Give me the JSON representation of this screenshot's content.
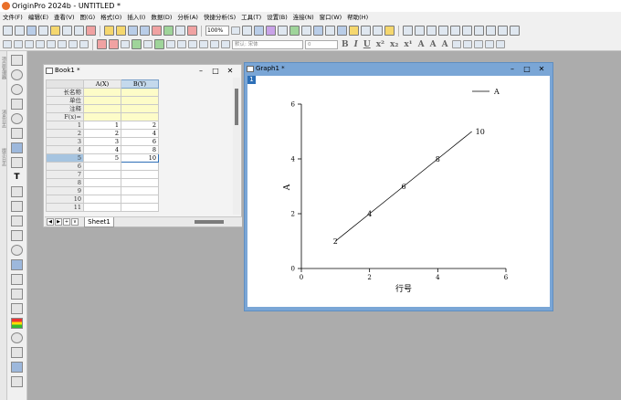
{
  "app": {
    "title": "OriginPro 2024b - UNTITLED *"
  },
  "menu": [
    "文件(F)",
    "编辑(E)",
    "查看(V)",
    "图(G)",
    "格式(O)",
    "插入(I)",
    "数据(D)",
    "分析(A)",
    "快捷分析(S)",
    "工具(T)",
    "设置(B)",
    "连接(N)",
    "窗口(W)",
    "帮助(H)"
  ],
  "toolbar": {
    "zoom": "100%",
    "font": "默认: 宋体",
    "size": "0",
    "format_labels": [
      "B",
      "I",
      "U",
      "x²",
      "x₂",
      "x¹",
      "A",
      "A",
      "A"
    ]
  },
  "left_panel": [
    "项目管理器",
    "消息日志",
    "提示日志"
  ],
  "book": {
    "title": "Book1 *",
    "columns": [
      "A(X)",
      "B(Y)"
    ],
    "meta_labels": [
      "长名称",
      "单位",
      "注释",
      "F(x)="
    ],
    "row_numbers": [
      "1",
      "2",
      "3",
      "4",
      "5",
      "6",
      "7",
      "8",
      "9",
      "10",
      "11"
    ],
    "rows": [
      [
        "1",
        "2"
      ],
      [
        "2",
        "4"
      ],
      [
        "3",
        "6"
      ],
      [
        "4",
        "8"
      ],
      [
        "5",
        "10"
      ],
      [
        "",
        ""
      ],
      [
        "",
        ""
      ],
      [
        "",
        ""
      ],
      [
        "",
        ""
      ],
      [
        "",
        ""
      ],
      [
        "",
        ""
      ]
    ],
    "sheet_tab": "Sheet1",
    "nav": [
      "◀",
      "▶",
      "+",
      "∨"
    ]
  },
  "graph": {
    "title": "Graph1 *",
    "layer": "1",
    "window_buttons": [
      "–",
      "□",
      "✕"
    ],
    "chart_data": {
      "type": "line",
      "x": [
        1,
        2,
        3,
        4,
        5
      ],
      "series": [
        {
          "name": "A",
          "values": [
            2,
            4,
            6,
            8,
            10
          ],
          "point_labels": [
            "2",
            "4",
            "6",
            "8",
            "10"
          ]
        }
      ],
      "xlabel": "行号",
      "ylabel": "A",
      "xlim": [
        0,
        6
      ],
      "ylim": [
        0,
        6
      ],
      "xticks": [
        "0",
        "2",
        "4",
        "6"
      ],
      "yticks": [
        "0",
        "2",
        "4",
        "6"
      ],
      "legend": "top-right",
      "grid": false,
      "color": "#000000"
    }
  },
  "colors": {
    "graph_frame": "#7aa6d6",
    "selected_row": "#a6c4e0",
    "meta_rows": "#fdfcc8"
  }
}
